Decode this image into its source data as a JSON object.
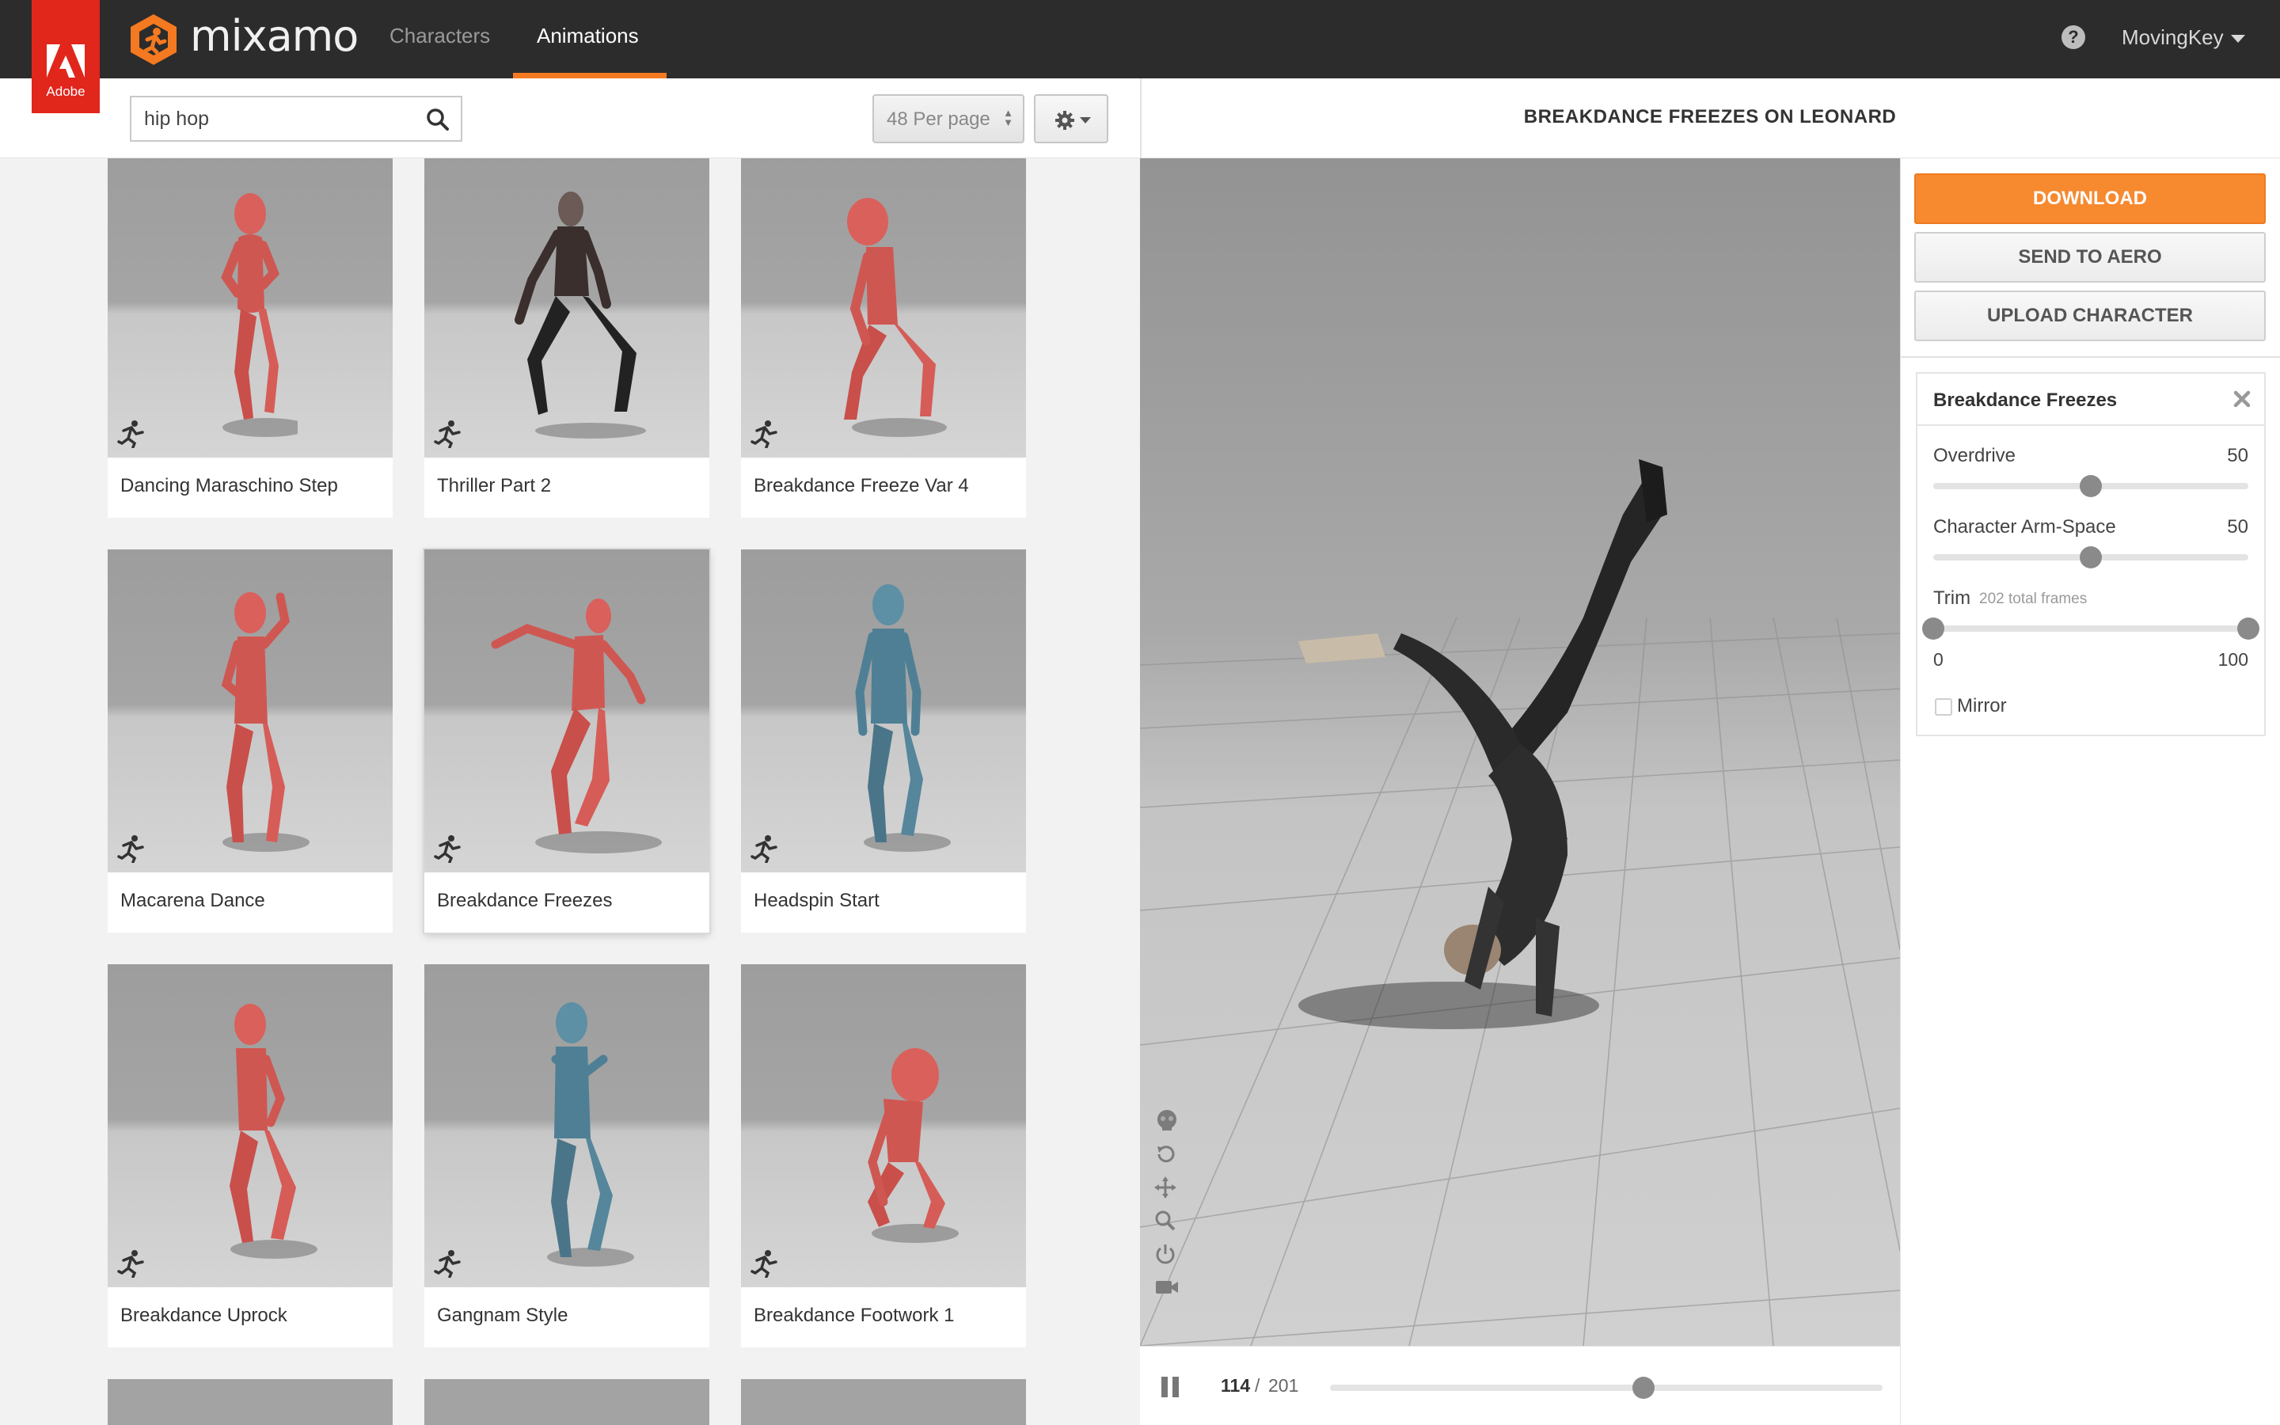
{
  "header": {
    "adobe_label": "Adobe",
    "brand": "mixamo",
    "tabs": [
      {
        "label": "Characters",
        "active": false
      },
      {
        "label": "Animations",
        "active": true
      }
    ],
    "user": "MovingKey",
    "accent_color": "#f47920"
  },
  "search": {
    "value": "hip hop",
    "per_page": "48 Per page"
  },
  "animations": [
    {
      "label": "Dancing Maraschino Step",
      "model": "red"
    },
    {
      "label": "Thriller Part 2",
      "model": "zombie"
    },
    {
      "label": "Breakdance Freeze Var 4",
      "model": "red"
    },
    {
      "label": "Macarena Dance",
      "model": "red"
    },
    {
      "label": "Breakdance Freezes",
      "model": "red",
      "selected": true
    },
    {
      "label": "Headspin Start",
      "model": "blue"
    },
    {
      "label": "Breakdance Uprock",
      "model": "red"
    },
    {
      "label": "Gangnam Style",
      "model": "blue"
    },
    {
      "label": "Breakdance Footwork 1",
      "model": "red"
    }
  ],
  "viewer": {
    "title": "BREAKDANCE FREEZES ON LEONARD",
    "current_frame": "114",
    "separator": "/",
    "total_frames": "201",
    "progress": 0.567
  },
  "actions": {
    "download": "DOWNLOAD",
    "send_to_aero": "SEND TO AERO",
    "upload_character": "UPLOAD CHARACTER"
  },
  "settings": {
    "title": "Breakdance Freezes",
    "overdrive": {
      "label": "Overdrive",
      "value": 50,
      "value_text": "50"
    },
    "arm_space": {
      "label": "Character Arm-Space",
      "value": 50,
      "value_text": "50"
    },
    "trim": {
      "label": "Trim",
      "note": "202 total frames",
      "min": 0,
      "max": 100,
      "min_text": "0",
      "max_text": "100"
    },
    "mirror": {
      "label": "Mirror",
      "checked": false
    }
  }
}
